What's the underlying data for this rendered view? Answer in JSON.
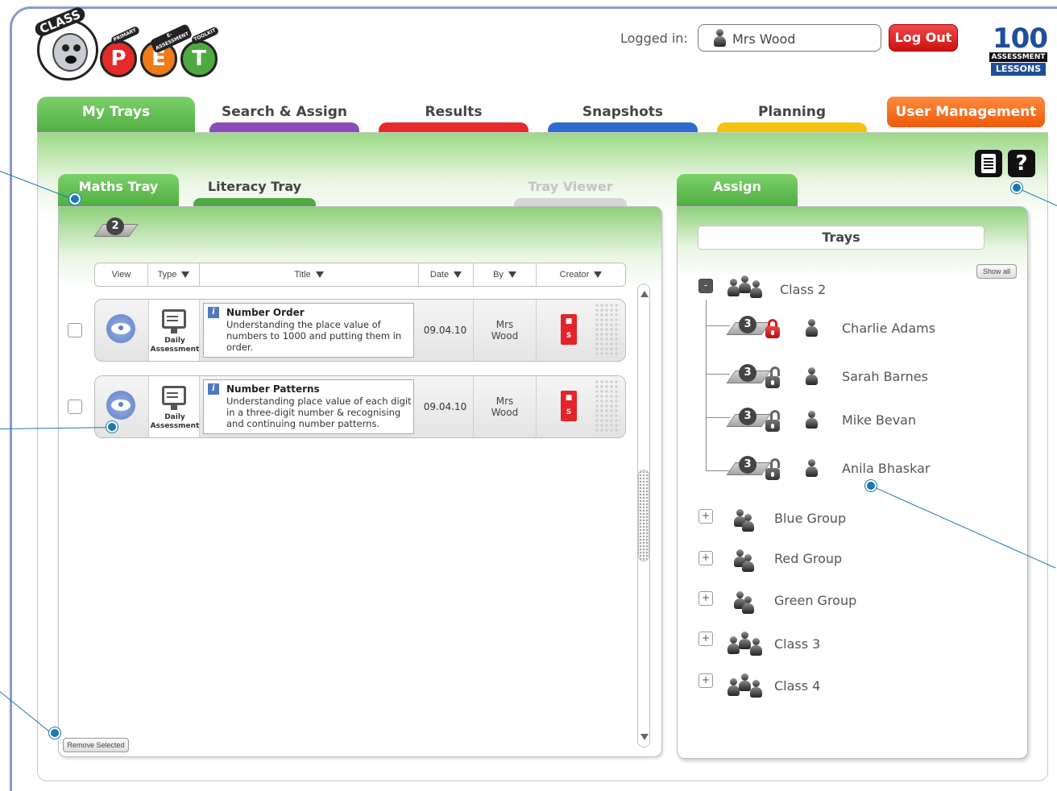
{
  "header": {
    "logo": {
      "word": "CLASS",
      "letters": [
        "P",
        "E",
        "T"
      ],
      "pills": [
        "PRIMARY",
        "E-ASSESSMENT",
        "TOOLKIT"
      ]
    },
    "logged_in_label": "Logged in:",
    "username": "Mrs Wood",
    "logout_label": "Log Out",
    "badge": {
      "number": "100",
      "line1": "ASSESSMENT",
      "line2": "LESSONS"
    }
  },
  "main_tabs": [
    {
      "label": "My Trays",
      "color": "#4caa3e"
    },
    {
      "label": "Search & Assign",
      "color": "#8a4db8"
    },
    {
      "label": "Results",
      "color": "#e52a2a"
    },
    {
      "label": "Snapshots",
      "color": "#2e6ad0"
    },
    {
      "label": "Planning",
      "color": "#f2c20c"
    },
    {
      "label": "User Management",
      "color": "#ee5a0a"
    }
  ],
  "toolbar": {
    "notes_icon": "notes-icon",
    "help_label": "?"
  },
  "sub_tabs": {
    "maths": "Maths Tray",
    "literacy": "Literacy Tray",
    "viewer": "Tray Viewer",
    "assign": "Assign"
  },
  "tray": {
    "count": "2",
    "columns": [
      "View",
      "Type",
      "Title",
      "Date",
      "By",
      "Creator"
    ],
    "rows": [
      {
        "type": "Daily Assessment",
        "title": "Number Order",
        "description": "Understanding the place value of numbers to 1000 and putting them in order.",
        "date": "09.04.10",
        "by_line1": "Mrs",
        "by_line2": "Wood",
        "creator_letter": "S"
      },
      {
        "type": "Daily Assessment",
        "title": "Number Patterns",
        "description": "Understanding place value of each digit in a three-digit number & recognising and continuing number patterns.",
        "date": "09.04.10",
        "by_line1": "Mrs",
        "by_line2": "Wood",
        "creator_letter": "S"
      }
    ],
    "remove_label": "Remove Selected"
  },
  "assign": {
    "header": "Trays",
    "show_all_label": "Show all",
    "class_expanded": {
      "label": "Class 2",
      "toggle": "-"
    },
    "students": [
      {
        "name": "Charlie Adams",
        "tray_count": "3",
        "lock": "locked"
      },
      {
        "name": "Sarah Barnes",
        "tray_count": "3",
        "lock": "unlocked"
      },
      {
        "name": "Mike Bevan",
        "tray_count": "3",
        "lock": "unlocked"
      },
      {
        "name": "Anila Bhaskar",
        "tray_count": "3",
        "lock": "unlocked"
      }
    ],
    "groups": [
      {
        "label": "Blue Group",
        "toggle": "+"
      },
      {
        "label": "Red Group",
        "toggle": "+"
      },
      {
        "label": "Green Group",
        "toggle": "+"
      },
      {
        "label": "Class 3",
        "toggle": "+"
      },
      {
        "label": "Class 4",
        "toggle": "+"
      }
    ]
  },
  "colors": {
    "accent_green": "#4caa3e",
    "annotation_blue": "#1a7ab0",
    "logout_red": "#cc1111"
  }
}
